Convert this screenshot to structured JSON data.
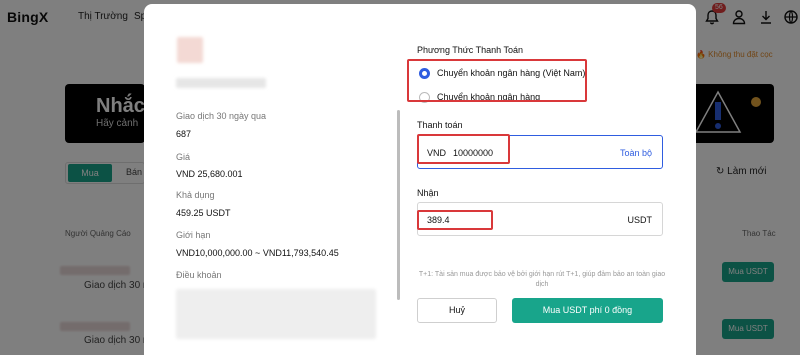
{
  "header": {
    "logo": "BingX",
    "nav": [
      "Thị Trường",
      "Sp"
    ],
    "notification_count": "56",
    "deposit_tip": "🔥 Không thu đặt cọc"
  },
  "background": {
    "banner_title": "Nhắc",
    "banner_sub": "Hãy cảnh",
    "tab_buy": "Mua",
    "tab_sell": "Bán",
    "refresh": "Làm mới",
    "col_advertiser": "Người Quảng Cáo",
    "col_action": "Thao Tác",
    "rows": [
      {
        "text": "Giao dịch 30 ng",
        "button": "Mua USDT"
      },
      {
        "text": "Giao dịch 30 ng",
        "button": "Mua USDT"
      }
    ]
  },
  "modal": {
    "info": [
      {
        "label": "Giao dịch 30 ngày qua",
        "value": "687"
      },
      {
        "label": "Giá",
        "value": "VND 25,680.001"
      },
      {
        "label": "Khả dụng",
        "value": "459.25 USDT"
      },
      {
        "label": "Giới hạn",
        "value": "VND10,000,000.00 ~ VND11,793,540.45"
      },
      {
        "label": "Điều khoản",
        "value": ""
      }
    ],
    "payment_method_title": "Phương Thức Thanh Toán",
    "payment_methods": [
      {
        "label": "Chuyển khoản ngân hàng (Việt Nam)",
        "selected": true
      },
      {
        "label": "Chuyển khoản ngân hàng",
        "selected": false
      }
    ],
    "pay": {
      "title": "Thanh toán",
      "currency": "VND",
      "value": "10000000",
      "all_label": "Toàn bộ"
    },
    "receive": {
      "title": "Nhận",
      "value": "389.4",
      "currency": "USDT"
    },
    "note": "T+1: Tài sản mua được bảo vệ bởi giới hạn rút T+1, giúp đảm bảo an toàn giao dịch",
    "cancel_label": "Huỷ",
    "confirm_label": "Mua USDT phí 0 đồng"
  },
  "colors": {
    "accent": "#18a58b",
    "selected": "#2f5de0",
    "highlight": "#d9383a"
  }
}
